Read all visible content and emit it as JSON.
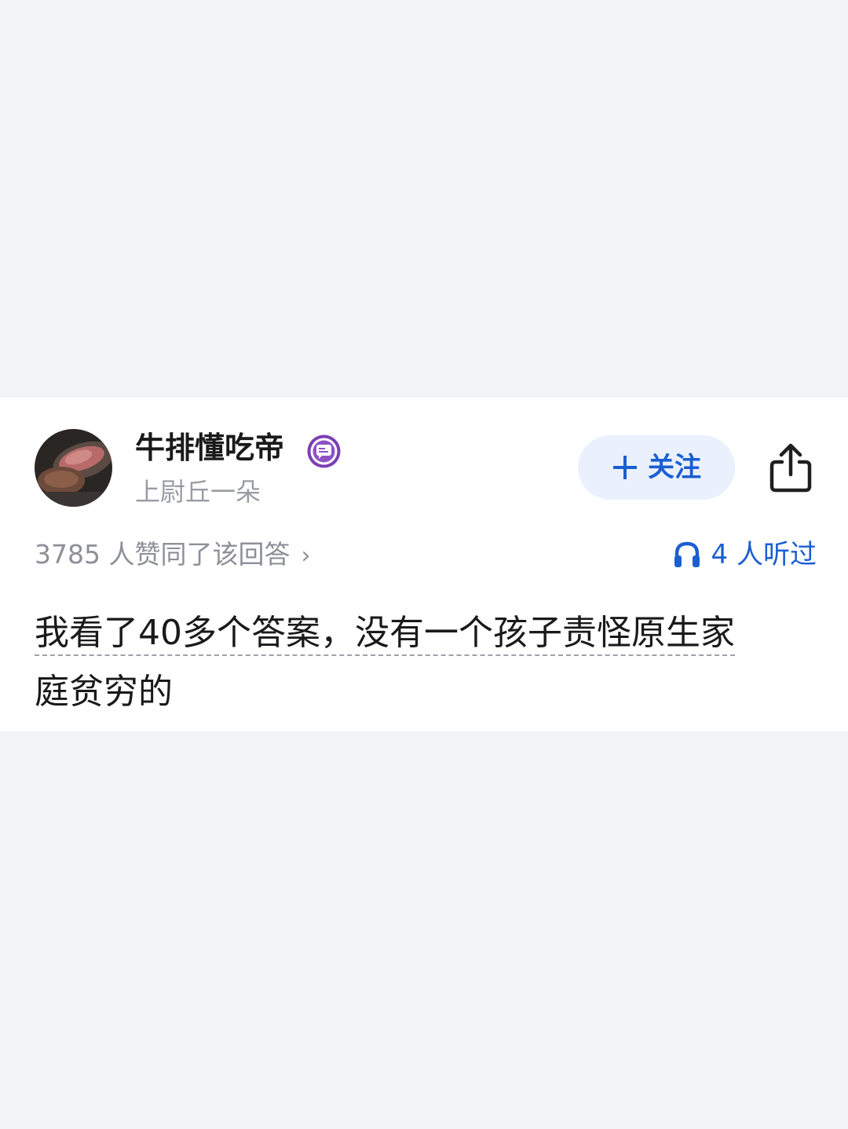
{
  "author": {
    "name": "牛排懂吃帝",
    "subtitle": "上尉丘一朵",
    "badge_icon": "message-badge-icon"
  },
  "actions": {
    "follow_icon": "plus-icon",
    "follow_label": "关注",
    "share_icon": "share-icon"
  },
  "stats": {
    "likes_text": "3785 人赞同了该回答",
    "likes_chevron": "›",
    "listen_icon": "headphones-icon",
    "listen_text": "4 人听过"
  },
  "answer": {
    "line1": "我看了40多个答案，没有一个孩子责怪原生家",
    "line2": "庭贫穷的"
  },
  "colors": {
    "accent": "#1a5fd1",
    "follow_bg": "#eaf1fd",
    "badge": "#7b3fb3",
    "page_bg": "#f2f3f5"
  }
}
